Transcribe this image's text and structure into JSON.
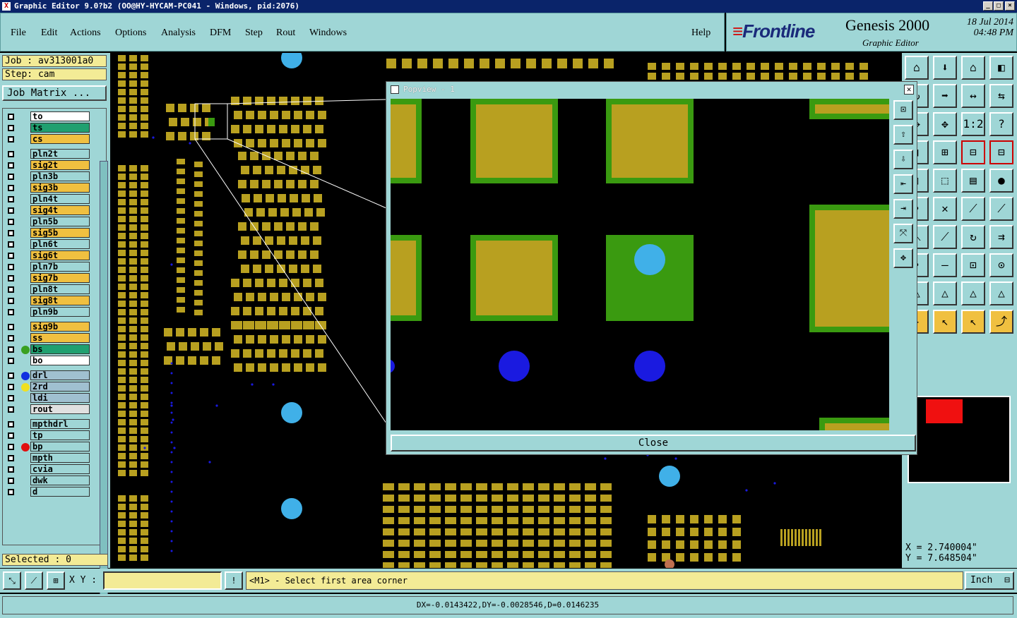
{
  "window": {
    "title": "Graphic Editor 9.0?b2 (OO@HY-HYCAM-PC041 - Windows, pid:2076)",
    "controls": [
      "_",
      "□",
      "×"
    ]
  },
  "menu": [
    "File",
    "Edit",
    "Actions",
    "Options",
    "Analysis",
    "DFM",
    "Step",
    "Rout",
    "Windows"
  ],
  "help": "Help",
  "brand": {
    "logo": "Frontline",
    "product": "Genesis 2000",
    "subtitle": "Graphic Editor",
    "date": "18 Jul 2014",
    "time": "04:48 PM"
  },
  "job": {
    "job_label": "Job : av313001a0",
    "step_label": "Step: cam",
    "matrix_button": "Job Matrix ..."
  },
  "layers": [
    {
      "name": "to",
      "color": "#ffffff",
      "dot": ""
    },
    {
      "name": "ts",
      "color": "#20a070",
      "dot": ""
    },
    {
      "name": "cs",
      "color": "#f0c040",
      "dot": ""
    },
    {
      "name": "pln2t",
      "color": "#9fd6d6",
      "dot": ""
    },
    {
      "name": "sig2t",
      "color": "#f0c040",
      "dot": ""
    },
    {
      "name": "pln3b",
      "color": "#9fd6d6",
      "dot": ""
    },
    {
      "name": "sig3b",
      "color": "#f0c040",
      "dot": ""
    },
    {
      "name": "pln4t",
      "color": "#9fd6d6",
      "dot": ""
    },
    {
      "name": "sig4t",
      "color": "#f0c040",
      "dot": ""
    },
    {
      "name": "pln5b",
      "color": "#9fd6d6",
      "dot": ""
    },
    {
      "name": "sig5b",
      "color": "#f0c040",
      "dot": ""
    },
    {
      "name": "pln6t",
      "color": "#9fd6d6",
      "dot": ""
    },
    {
      "name": "sig6t",
      "color": "#f0c040",
      "dot": ""
    },
    {
      "name": "pln7b",
      "color": "#9fd6d6",
      "dot": ""
    },
    {
      "name": "sig7b",
      "color": "#f0c040",
      "dot": ""
    },
    {
      "name": "pln8t",
      "color": "#9fd6d6",
      "dot": ""
    },
    {
      "name": "sig8t",
      "color": "#f0c040",
      "dot": ""
    },
    {
      "name": "pln9b",
      "color": "#9fd6d6",
      "dot": ""
    },
    {
      "name": "sig9b",
      "color": "#f0c040",
      "dot": ""
    },
    {
      "name": "ss",
      "color": "#f0c040",
      "dot": ""
    },
    {
      "name": "bs",
      "color": "#20a070",
      "dot": "#3aa020"
    },
    {
      "name": "bo",
      "color": "#ffffff",
      "dot": ""
    },
    {
      "name": "drl",
      "color": "#a0c0d0",
      "dot": "#1030e0"
    },
    {
      "name": "2rd",
      "color": "#a0c0d0",
      "dot": "#f0e020"
    },
    {
      "name": "ldi",
      "color": "#a0c0d0",
      "dot": ""
    },
    {
      "name": "rout",
      "color": "#e0e0e0",
      "dot": ""
    },
    {
      "name": "mpthdrl",
      "color": "#9fd6d6",
      "dot": ""
    },
    {
      "name": "tp",
      "color": "#9fd6d6",
      "dot": ""
    },
    {
      "name": "bp",
      "color": "#9fd6d6",
      "dot": "#e01010"
    },
    {
      "name": "mpth",
      "color": "#9fd6d6",
      "dot": ""
    },
    {
      "name": "cvia",
      "color": "#9fd6d6",
      "dot": ""
    },
    {
      "name": "dwk",
      "color": "#9fd6d6",
      "dot": ""
    },
    {
      "name": "d",
      "color": "#9fd6d6",
      "dot": ""
    }
  ],
  "selected": "Selected : 0",
  "popview": {
    "title": "Popview - 1",
    "close_label": "Close"
  },
  "coords": {
    "x": "X = 2.740004\"",
    "y": "Y = 7.648504\""
  },
  "cmd": {
    "xy_label": "X Y :",
    "xy_value": "",
    "prompt": "<M1> - Select first area corner",
    "units": "Inch"
  },
  "status": "DX=-0.0143422,DY=-0.0028546,D=0.0146235",
  "colors": {
    "pad": "#b8a020",
    "mask": "#3a9a10",
    "drill": "#1a1ae0",
    "via": "#40b0e8",
    "panel": "#9fd6d6"
  }
}
